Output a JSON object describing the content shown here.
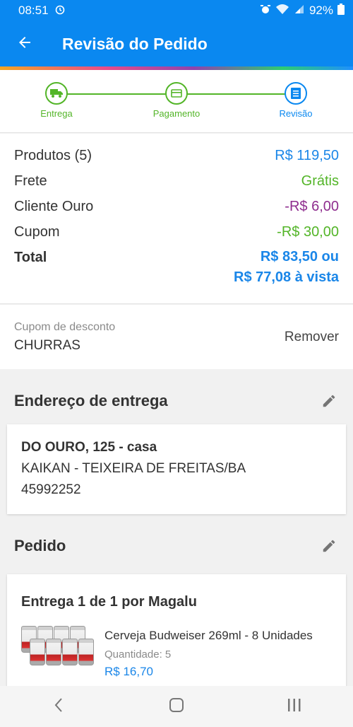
{
  "status_bar": {
    "time": "08:51",
    "battery": "92%",
    "icons": [
      "alarm-icon",
      "wifi-icon",
      "signal-icon",
      "battery-icon"
    ]
  },
  "app_bar": {
    "title": "Revisão do Pedido"
  },
  "stepper": {
    "steps": [
      {
        "label": "Entrega",
        "icon": "truck-icon"
      },
      {
        "label": "Pagamento",
        "icon": "card-icon"
      },
      {
        "label": "Revisão",
        "icon": "list-icon"
      }
    ],
    "active_index": 2
  },
  "summary": {
    "products_label": "Produtos (5)",
    "products_value": "R$ 119,50",
    "shipping_label": "Frete",
    "shipping_value": "Grátis",
    "gold_label": "Cliente Ouro",
    "gold_value": "-R$ 6,00",
    "coupon_label": "Cupom",
    "coupon_value": "-R$ 30,00",
    "total_label": "Total",
    "total_value_1": "R$ 83,50 ou",
    "total_value_2": "R$ 77,08 à vista"
  },
  "coupon": {
    "label": "Cupom de desconto",
    "code": "CHURRAS",
    "remove_label": "Remover"
  },
  "address_section": {
    "title": "Endereço de entrega",
    "line1": "DO OURO, 125 - casa",
    "line2": "KAIKAN - TEIXEIRA DE FREITAS/BA",
    "line3": "45992252"
  },
  "order_section": {
    "title": "Pedido",
    "delivery_title": "Entrega 1 de 1 por Magalu",
    "item": {
      "name": "Cerveja Budweiser 269ml - 8 Unidades",
      "quantity_label": "Quantidade:",
      "quantity": "5",
      "price": "R$ 16,70"
    }
  },
  "colors": {
    "primary": "#0a88f0",
    "success": "#53b528",
    "purple": "#8e2d8e"
  }
}
